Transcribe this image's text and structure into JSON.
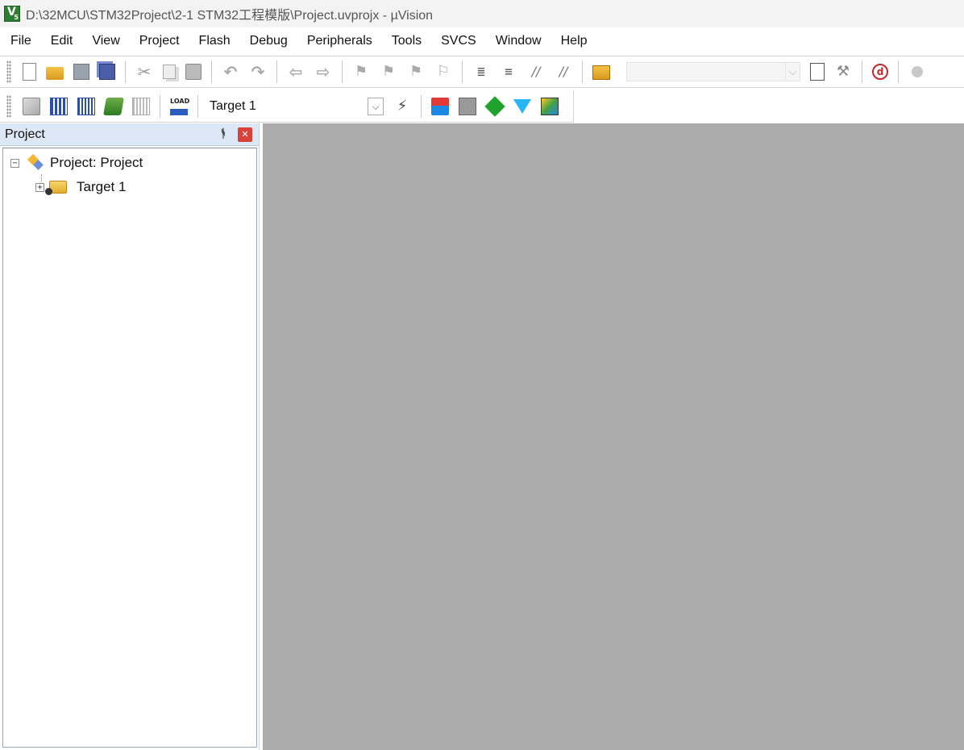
{
  "window": {
    "title": "D:\\32MCU\\STM32Project\\2-1 STM32工程模版\\Project.uvprojx - µVision",
    "app_icon": "uvision-app-icon"
  },
  "menu": {
    "items": [
      "File",
      "Edit",
      "View",
      "Project",
      "Flash",
      "Debug",
      "Peripherals",
      "Tools",
      "SVCS",
      "Window",
      "Help"
    ]
  },
  "toolbar_file": {
    "icons": [
      "new-file-icon",
      "open-folder-icon",
      "save-icon",
      "save-all-icon",
      "cut-icon",
      "copy-icon",
      "paste-icon",
      "undo-icon",
      "redo-icon",
      "navigate-back-icon",
      "navigate-forward-icon",
      "bookmark-toggle-icon",
      "bookmark-prev-icon",
      "bookmark-next-icon",
      "bookmark-clear-icon",
      "indent-icon",
      "unindent-icon",
      "comment-icon",
      "uncomment-icon",
      "find-in-files-icon",
      "find-combo",
      "incremental-find-icon",
      "source-browser-icon",
      "debug-session-icon",
      "breakpoint-icon"
    ],
    "find_combo_value": ""
  },
  "toolbar_build": {
    "icons": [
      "translate-icon",
      "build-icon",
      "rebuild-icon",
      "batch-build-icon",
      "stop-build-icon",
      "download-load-icon",
      "target-options-wand-icon",
      "manage-project-items-icon",
      "manage-multi-project-icon",
      "select-software-packs-icon",
      "manage-run-time-environment-icon",
      "pack-installer-icon"
    ],
    "load_label": "LOAD",
    "target_selected": "Target 1"
  },
  "project_panel": {
    "title": "Project",
    "pin_icon": "pin-icon",
    "close_icon": "close-icon",
    "tree": {
      "root_label": "Project: Project",
      "root_expanded": true,
      "children": [
        {
          "label": "Target 1",
          "expanded": false
        }
      ]
    }
  },
  "editor": {
    "background": "#ababab"
  }
}
